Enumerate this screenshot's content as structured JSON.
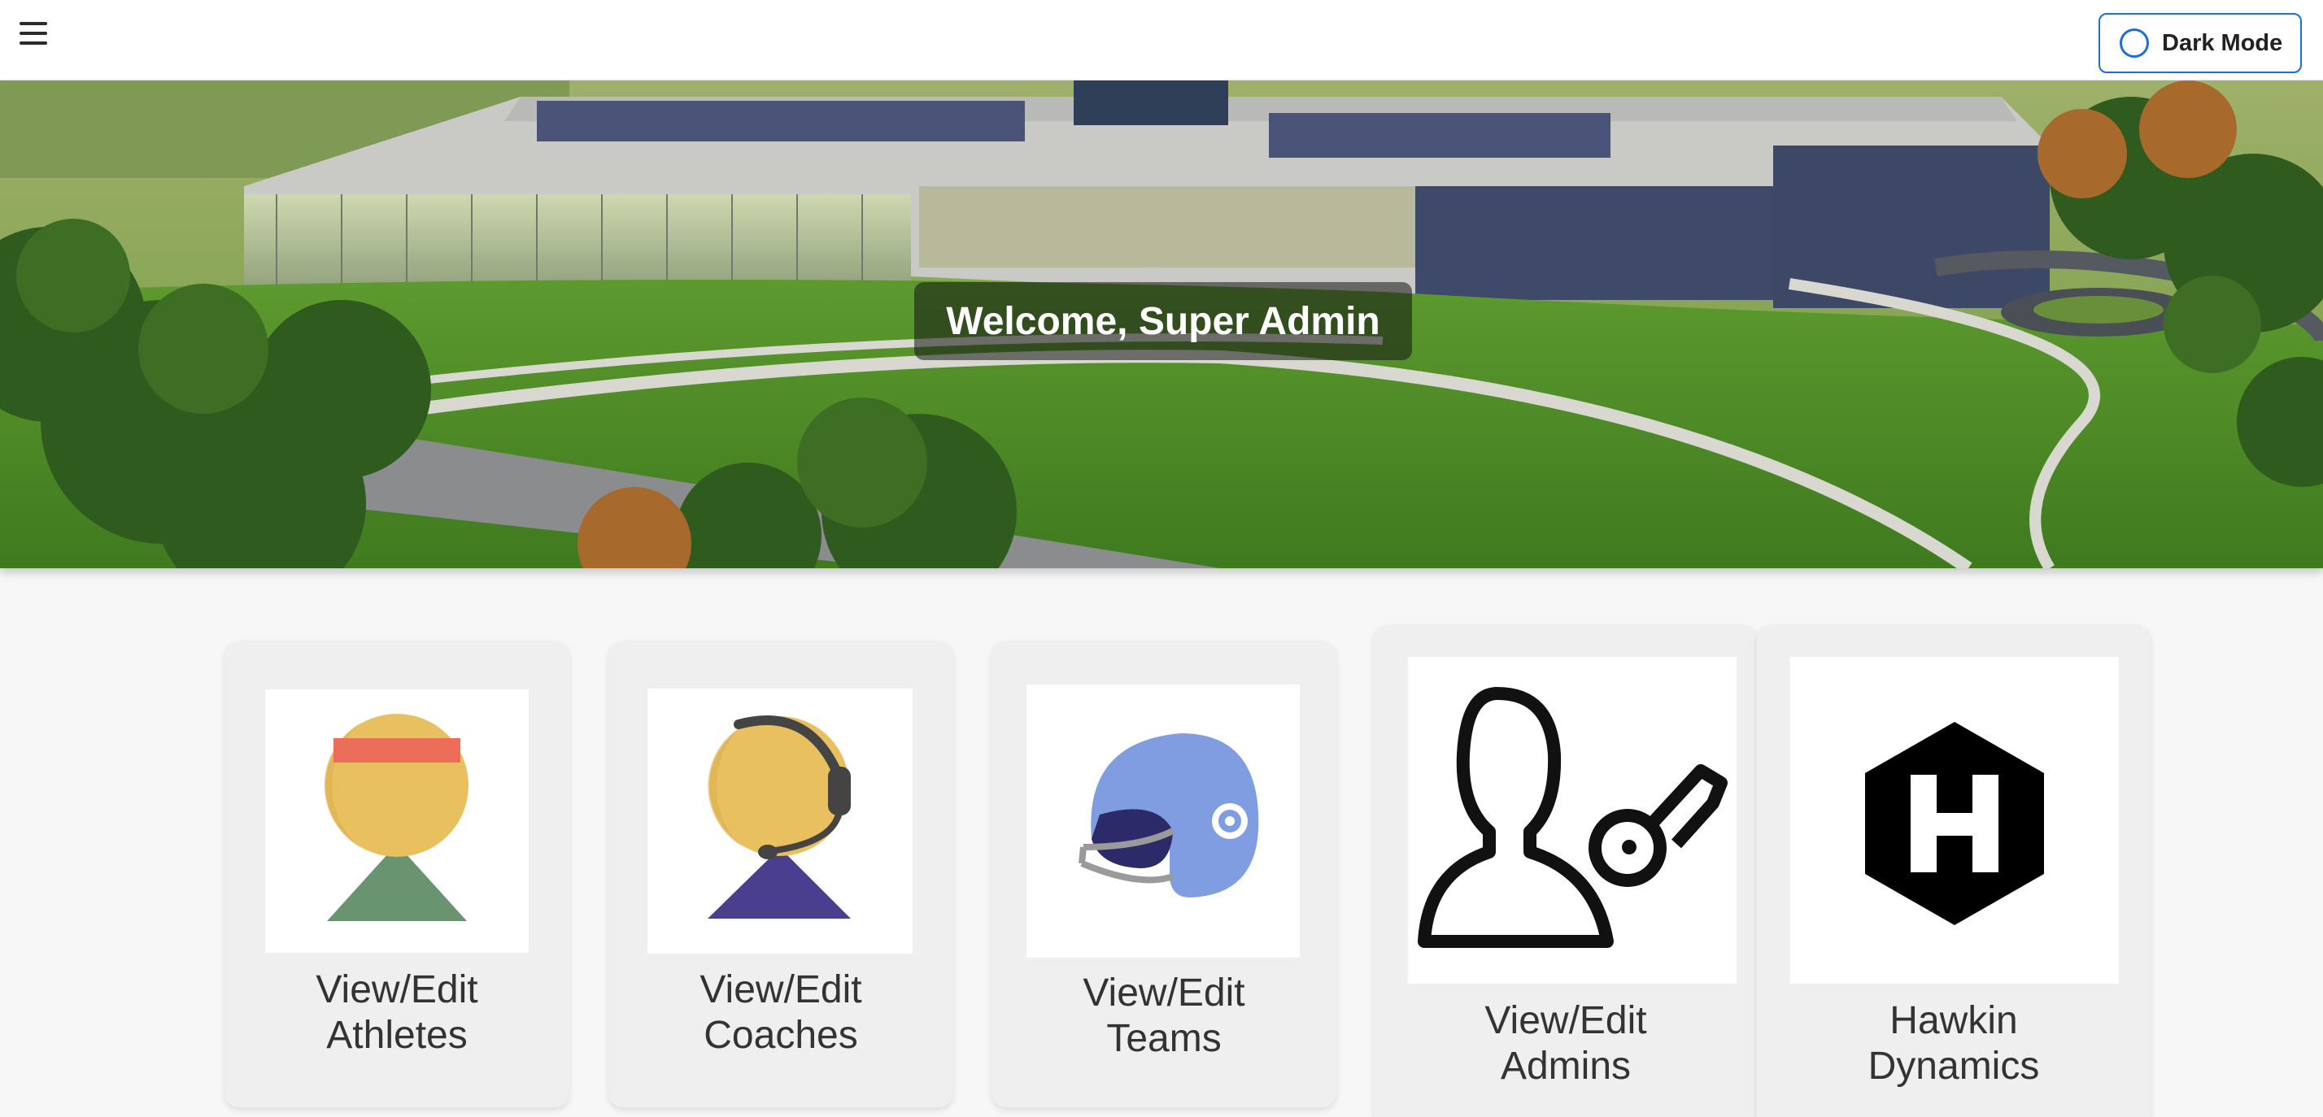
{
  "header": {
    "menu_icon": "hamburger-menu-icon",
    "dark_mode_label": "Dark Mode"
  },
  "hero": {
    "welcome_text": "Welcome, Super Admin"
  },
  "cards": [
    {
      "line1": "View/Edit",
      "line2": "Athletes",
      "icon": "athlete-icon"
    },
    {
      "line1": "View/Edit",
      "line2": "Coaches",
      "icon": "coach-icon"
    },
    {
      "line1": "View/Edit",
      "line2": "Teams",
      "icon": "football-helmet-icon"
    },
    {
      "line1": "View/Edit",
      "line2": "Admins",
      "icon": "admin-key-icon"
    },
    {
      "line1": "Hawkin",
      "line2": "Dynamics",
      "icon": "hawkin-dynamics-logo-icon"
    }
  ],
  "colors": {
    "accent": "#1c6fd6",
    "card_bg": "#efefef",
    "page_bg": "#f7f7f7"
  }
}
